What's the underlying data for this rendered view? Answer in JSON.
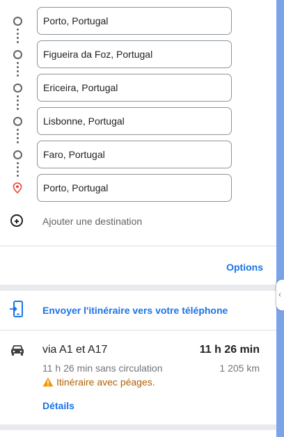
{
  "directions": {
    "stops": [
      {
        "value": "Porto, Portugal",
        "icon": "circle-icon"
      },
      {
        "value": "Figueira da Foz, Portugal",
        "icon": "circle-icon"
      },
      {
        "value": "Ericeira, Portugal",
        "icon": "circle-icon"
      },
      {
        "value": "Lisbonne, Portugal",
        "icon": "circle-icon"
      },
      {
        "value": "Faro, Portugal",
        "icon": "circle-icon"
      },
      {
        "value": "Porto, Portugal",
        "icon": "location-pin-icon"
      }
    ],
    "add_destination_label": "Ajouter une destination"
  },
  "options_label": "Options",
  "send_to_phone_label": "Envoyer l'itinéraire vers votre téléphone",
  "route": {
    "title": "via A1 et A17",
    "duration": "11 h 26 min",
    "without_traffic": "11 h 26 min sans circulation",
    "distance": "1 205 km",
    "warning": "Itinéraire avec péages.",
    "details_label": "Détails"
  },
  "colors": {
    "accent": "#1a73e8",
    "warning": "#f29900",
    "pin": "#ea4335",
    "scrollbar": "#7aa3e8"
  }
}
